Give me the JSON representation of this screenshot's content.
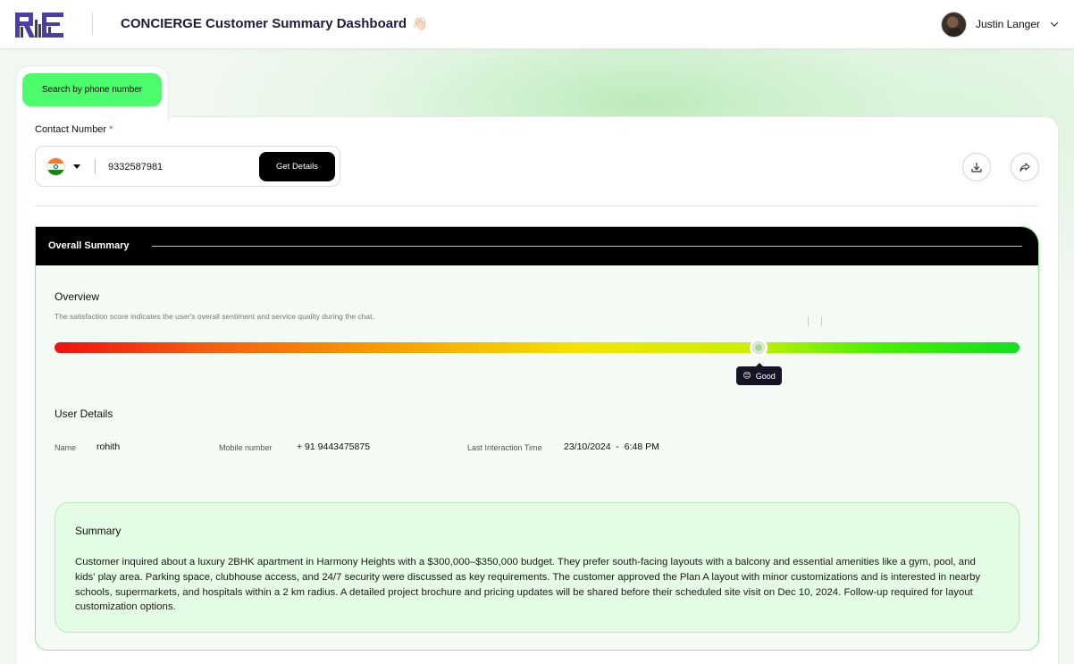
{
  "header": {
    "logo_text": "RE",
    "app_title": "CONCIERGE Customer Summary Dashboard",
    "title_emoji": "👋🏻",
    "user_name": "Justin Langer"
  },
  "search": {
    "tab_label": "Search by phone number",
    "contact_label": "Contact Number",
    "required_mark": "*",
    "country": "India",
    "phone_value": "9332587981",
    "get_details_label": "Get Details"
  },
  "toolbar": {
    "download_icon": "download-icon",
    "share_icon": "share-icon"
  },
  "overall_summary": {
    "title": "Overall Summary"
  },
  "overview": {
    "title": "Overview",
    "description": "The satisfaction score indicates the user's overall sentiment and service quality during the chat.",
    "score_percent": 73,
    "score_label": "Good",
    "score_emoji": "😊"
  },
  "user_details": {
    "title": "User Details",
    "name_label": "Name",
    "name_value": "rohith",
    "mobile_label": "Mobile number",
    "mobile_value": "+ 91 9443475875",
    "last_interaction_label": "Last Interaction Time",
    "last_interaction_value": "23/10/2024  -  6:48 PM"
  },
  "summary": {
    "title": "Summary",
    "text": "Customer inquired about a luxury 2BHK apartment in Harmony Heights with a $300,000–$350,000 budget. They prefer south-facing layouts with a balcony and essential amenities like a gym, pool, and kids' play area. Parking space, clubhouse access, and 24/7 security were discussed as key requirements. The customer approved the Plan A layout with minor customizations and is interested in nearby schools, supermarkets, and hospitals within a 2 km radius. A detailed project brochure and pricing updates will be shared before their scheduled site visit on Dec 10, 2024. Follow-up required for layout customization options."
  },
  "colors": {
    "accent_green": "#4cfc6c",
    "brand_purple": "#4a3aa8",
    "panel_header": "#000000"
  }
}
